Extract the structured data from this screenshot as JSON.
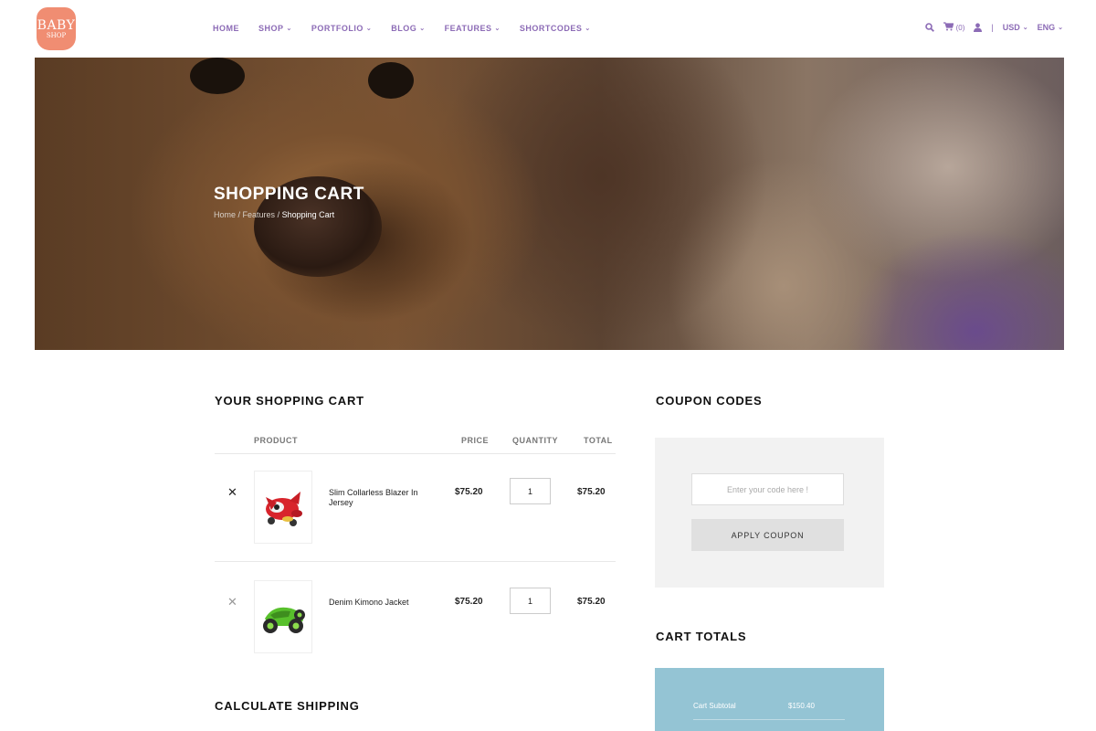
{
  "logo": {
    "line1": "BABY",
    "line2": "SHOP"
  },
  "nav": [
    {
      "label": "HOME",
      "dropdown": false
    },
    {
      "label": "SHOP",
      "dropdown": true
    },
    {
      "label": "PORTFOLIO",
      "dropdown": true
    },
    {
      "label": "BLOG",
      "dropdown": true
    },
    {
      "label": "FEATURES",
      "dropdown": true
    },
    {
      "label": "SHORTCODES",
      "dropdown": true
    }
  ],
  "tools": {
    "search_icon": "search-icon",
    "cart_icon": "cart-icon",
    "cart_count": "(0)",
    "user_icon": "user-icon",
    "separator": "|",
    "currency": "USD",
    "language": "ENG"
  },
  "hero": {
    "title": "SHOPPING CART",
    "breadcrumb": {
      "home": "Home",
      "sep": " / ",
      "features": "Features",
      "current": "Shopping Cart"
    }
  },
  "cart": {
    "title": "YOUR SHOPPING CART",
    "columns": {
      "product": "PRODUCT",
      "price": "PRICE",
      "quantity": "QUANTITY",
      "total": "TOTAL"
    },
    "items": [
      {
        "name": "Slim Collarless Blazer In Jersey",
        "price": "$75.20",
        "quantity": "1",
        "total": "$75.20",
        "remove": "✕"
      },
      {
        "name": "Denim Kimono Jacket",
        "price": "$75.20",
        "quantity": "1",
        "total": "$75.20",
        "remove": "✕"
      }
    ]
  },
  "shipping": {
    "title": "CALCULATE SHIPPING"
  },
  "coupon": {
    "title": "COUPON CODES",
    "placeholder": "Enter your code here !",
    "button": "APPLY COUPON"
  },
  "totals": {
    "title": "CART TOTALS",
    "subtotal_label": "Cart Subtotal",
    "subtotal_value": "$150.40"
  },
  "colors": {
    "accent": "#8c6bb6",
    "logo": "#f08d72",
    "totals_bg": "#94c4d4",
    "coupon_bg": "#f2f2f2"
  }
}
